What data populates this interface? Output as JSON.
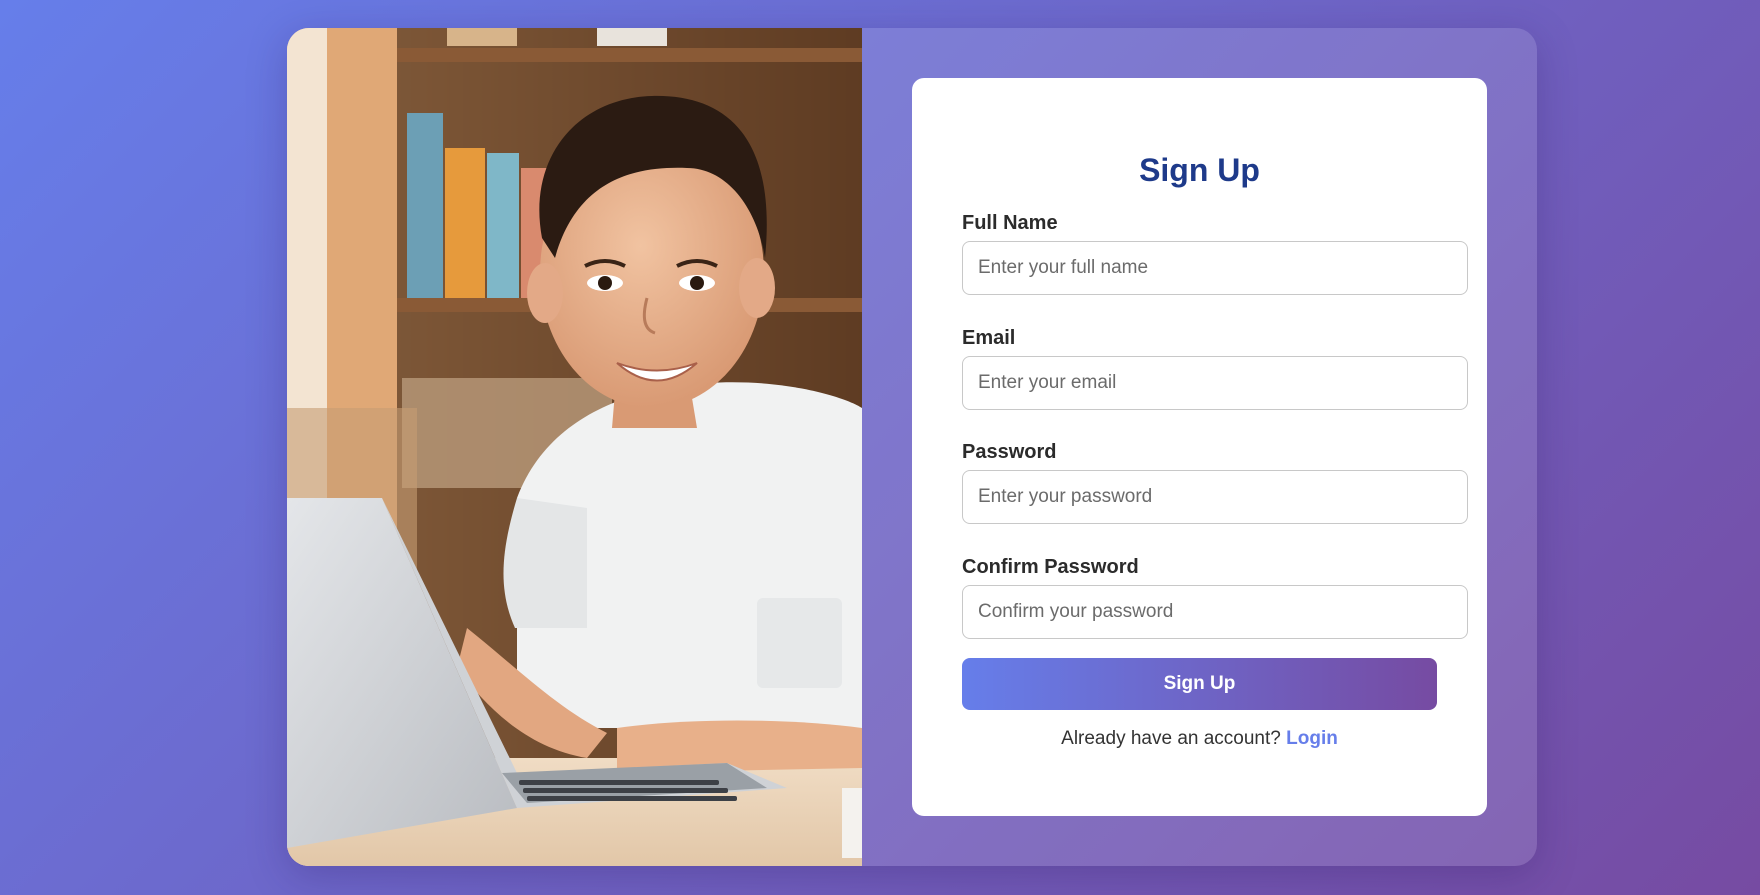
{
  "form": {
    "title": "Sign Up",
    "fields": [
      {
        "label": "Full Name",
        "placeholder": "Enter your full name",
        "type": "text"
      },
      {
        "label": "Email",
        "placeholder": "Enter your email",
        "type": "email"
      },
      {
        "label": "Password",
        "placeholder": "Enter your password",
        "type": "password"
      },
      {
        "label": "Confirm Password",
        "placeholder": "Confirm your password",
        "type": "password"
      }
    ],
    "submit_label": "Sign Up",
    "footer_text": "Already have an account?",
    "login_link": "Login"
  },
  "colors": {
    "bg_start": "#667eea",
    "bg_end": "#764ba2",
    "title": "#1e3a8a",
    "link": "#667eea"
  },
  "image": {
    "semantic": "photo of smiling boy at laptop in front of bookshelf"
  }
}
